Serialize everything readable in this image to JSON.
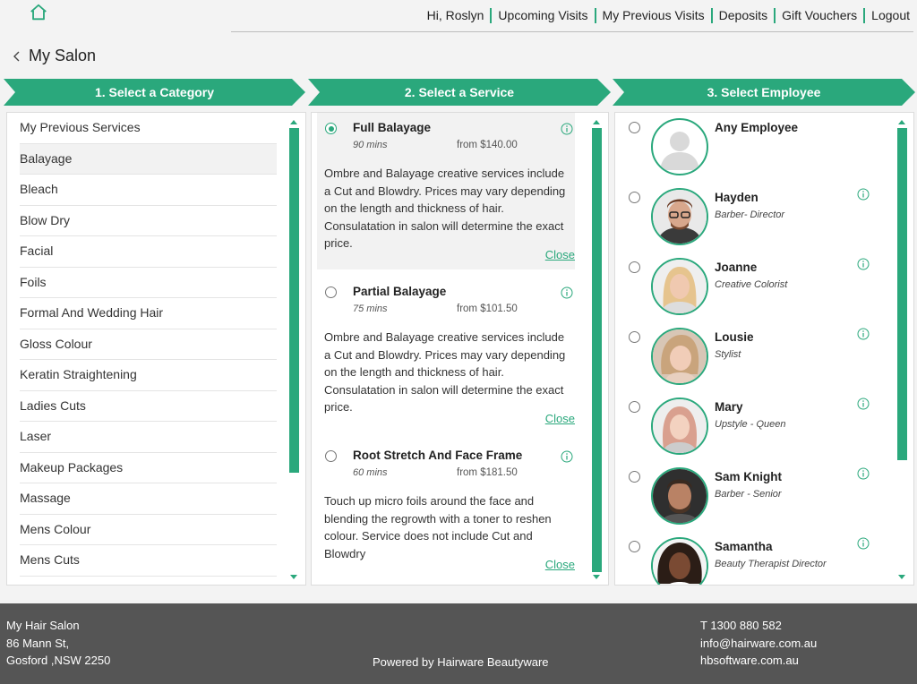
{
  "header": {
    "greeting": "Hi, Roslyn",
    "nav": [
      "Upcoming Visits",
      "My Previous Visits",
      "Deposits",
      "Gift Vouchers",
      "Logout"
    ]
  },
  "page_title": "My Salon",
  "steps": [
    "1. Select a Category",
    "2. Select a Service",
    "3. Select Employee"
  ],
  "categories": [
    "My Previous Services",
    "Balayage",
    "Bleach",
    "Blow Dry",
    "Facial",
    "Foils",
    "Formal And Wedding Hair",
    "Gloss Colour",
    "Keratin Straightening",
    "Ladies Cuts",
    "Laser",
    "Makeup Packages",
    "Massage",
    "Mens Colour",
    "Mens Cuts"
  ],
  "active_category": "Balayage",
  "services": [
    {
      "name": "Full Balayage",
      "duration": "90 mins",
      "price": "from $140.00",
      "description": "Ombre and Balayage creative services include a Cut and Blowdry. Prices may vary depending on the length and thickness of hair. Consulatation in salon will determine the exact price.",
      "close": "Close",
      "selected": true
    },
    {
      "name": "Partial Balayage",
      "duration": "75 mins",
      "price": "from $101.50",
      "description": "Ombre and Balayage creative services include a Cut and Blowdry. Prices may vary depending on the length and thickness of hair. Consulatation in salon will determine the exact price.",
      "close": "Close",
      "selected": false
    },
    {
      "name": "Root Stretch And Face Frame",
      "duration": "60 mins",
      "price": "from $181.50",
      "description": "Touch up micro foils around the face and blending the regrowth with a toner to reshen colour. Service does not include Cut and Blowdry",
      "close": "Close",
      "selected": false
    }
  ],
  "employees": [
    {
      "name": "Any Employee",
      "role": "",
      "avatar": "placeholder-avatar"
    },
    {
      "name": "Hayden",
      "role": "Barber- Director",
      "avatar": "photo"
    },
    {
      "name": "Joanne",
      "role": "Creative Colorist",
      "avatar": "photo"
    },
    {
      "name": "Lousie",
      "role": "Stylist",
      "avatar": "photo"
    },
    {
      "name": "Mary",
      "role": "Upstyle - Queen",
      "avatar": "photo"
    },
    {
      "name": "Sam Knight",
      "role": "Barber - Senior",
      "avatar": "photo"
    },
    {
      "name": "Samantha",
      "role": "Beauty Therapist Director",
      "avatar": "photo"
    }
  ],
  "footer": {
    "salon_name": "My Hair Salon",
    "address_line1": "86 Mann St,",
    "address_line2": "Gosford ,NSW 2250",
    "phone": "T 1300 880 582",
    "email": "info@hairware.com.au",
    "website": "hbsoftware.com.au",
    "powered_by": "Powered by Hairware Beautyware"
  },
  "colors": {
    "accent": "#2aa87c",
    "footer_bg": "#555555"
  }
}
